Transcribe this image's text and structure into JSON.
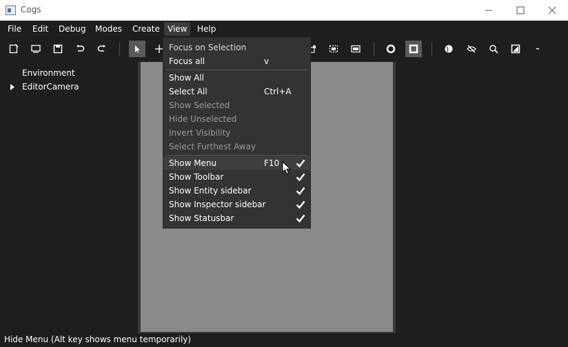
{
  "window": {
    "title": "Cogs"
  },
  "menubar": [
    "File",
    "Edit",
    "Debug",
    "Modes",
    "Create",
    "View",
    "Help"
  ],
  "active_menu": "View",
  "sidebar": {
    "items": [
      {
        "label": "Environment",
        "expandable": false
      },
      {
        "label": "EditorCamera",
        "expandable": true
      }
    ]
  },
  "view_menu": {
    "top": [
      {
        "label": "Focus on Selection",
        "shortcut": ""
      },
      {
        "label": "Focus all",
        "shortcut": "v"
      }
    ],
    "visibility": [
      {
        "label": "Show All",
        "shortcut": "",
        "disabled": false
      },
      {
        "label": "Select All",
        "shortcut": "Ctrl+A",
        "disabled": false
      },
      {
        "label": "Show Selected",
        "shortcut": "",
        "disabled": true
      },
      {
        "label": "Hide Unselected",
        "shortcut": "",
        "disabled": true
      },
      {
        "label": "Invert Visibility",
        "shortcut": "",
        "disabled": true
      },
      {
        "label": "Select Furthest Away",
        "shortcut": "",
        "disabled": true
      }
    ],
    "panels": [
      {
        "label": "Show Menu",
        "shortcut": "F10",
        "checked": true
      },
      {
        "label": "Show Toolbar",
        "shortcut": "",
        "checked": true
      },
      {
        "label": "Show Entity sidebar",
        "shortcut": "",
        "checked": true
      },
      {
        "label": "Show Inspector sidebar",
        "shortcut": "",
        "checked": true
      },
      {
        "label": "Show Statusbar",
        "shortcut": "",
        "checked": true
      }
    ]
  },
  "statusbar": {
    "text": "Hide Menu (Alt key shows menu temporarily)"
  },
  "colors": {
    "background": "#1e1e1e",
    "viewport": "#8a8a8a",
    "menu_bg": "#333333",
    "disabled_text": "#9a9a9a"
  }
}
